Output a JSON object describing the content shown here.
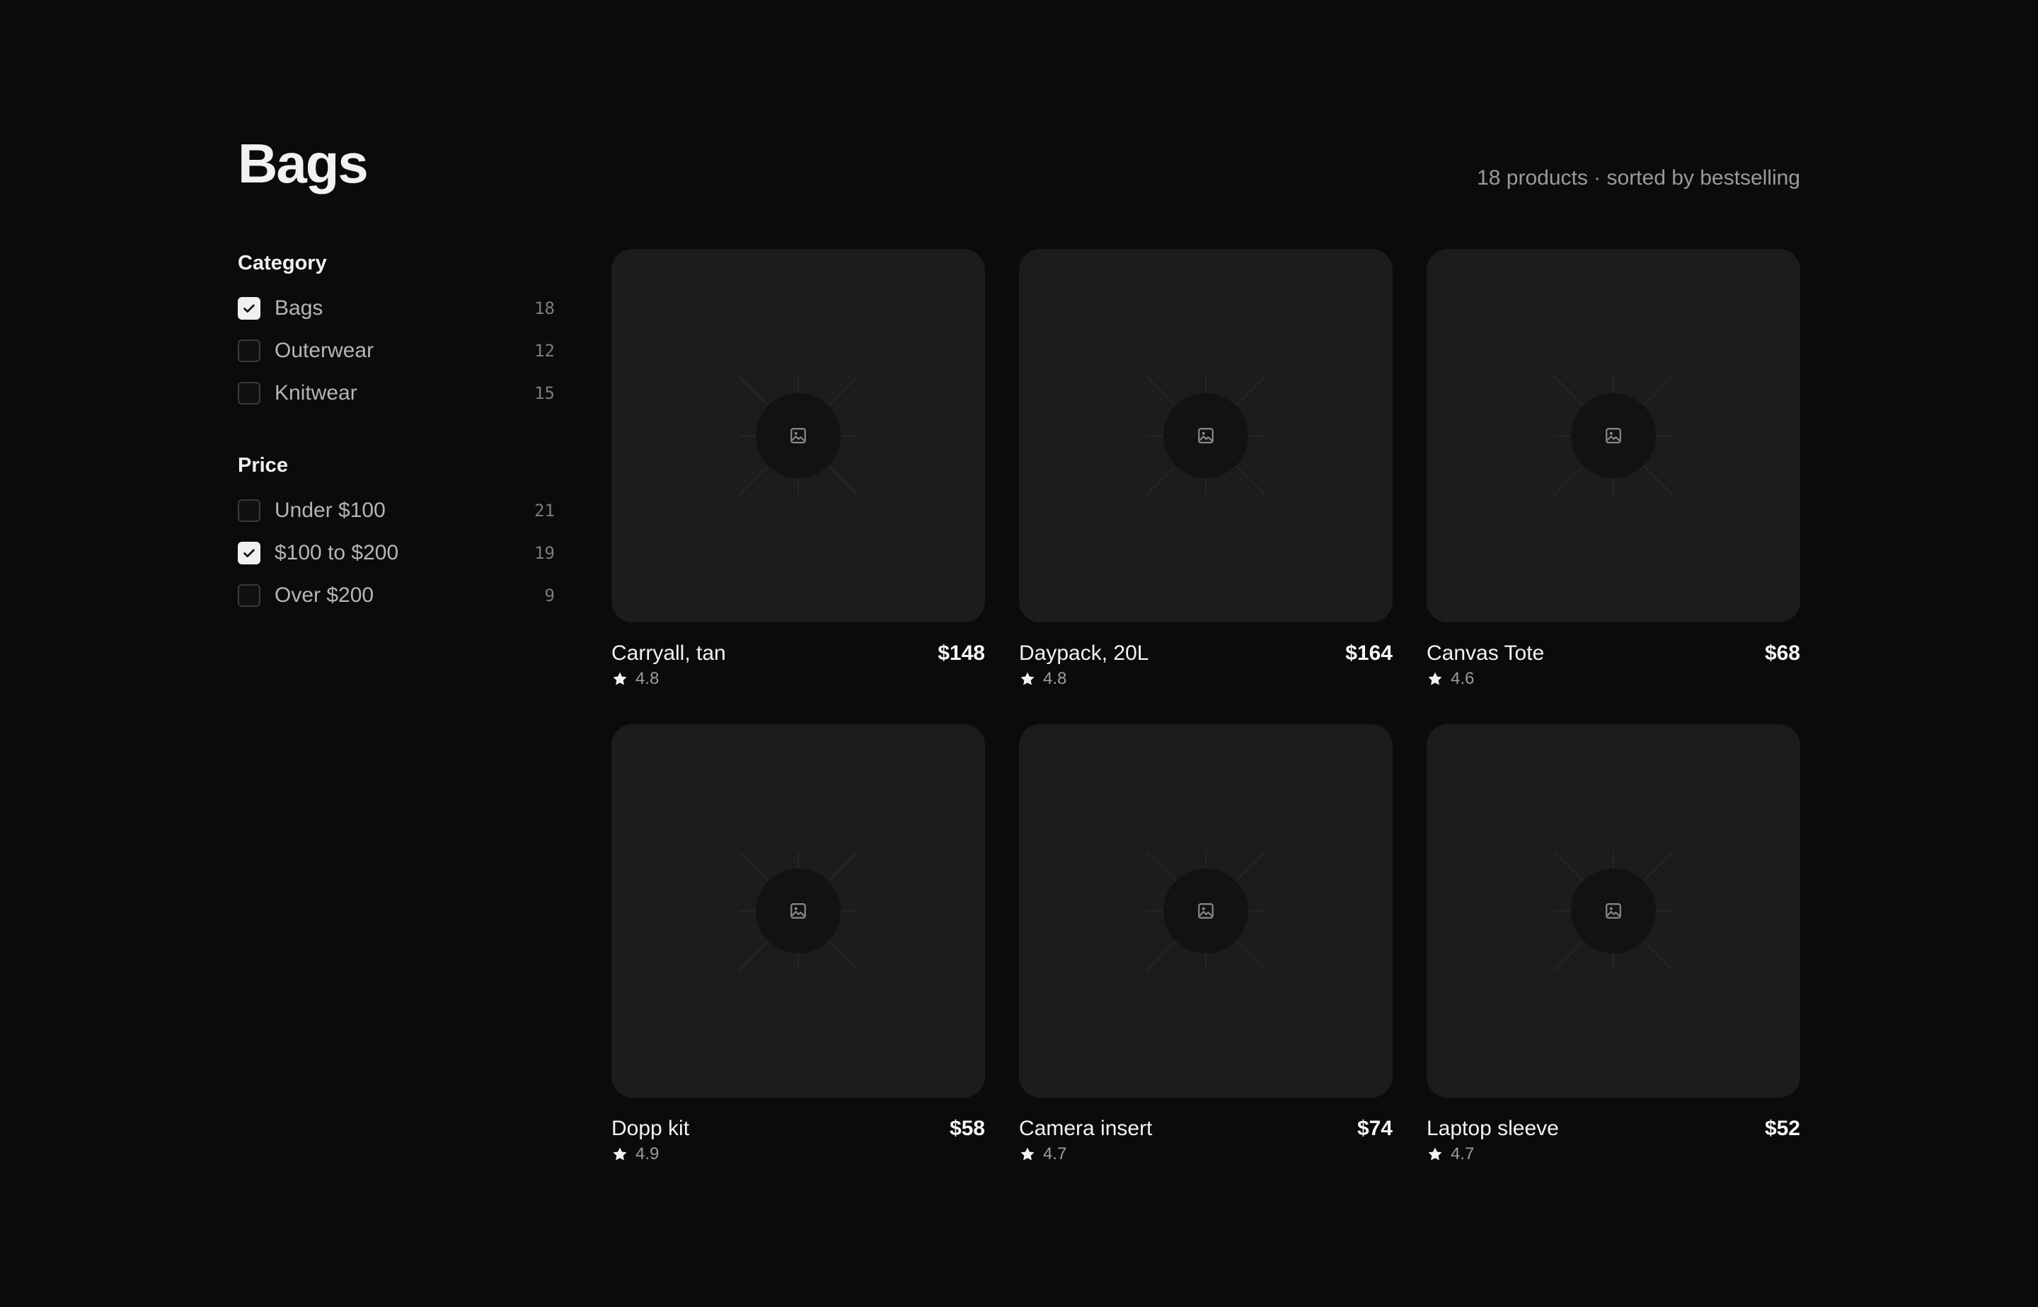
{
  "header": {
    "title": "Bags",
    "summary": "18 products · sorted by bestselling"
  },
  "filters": {
    "category": {
      "heading": "Category",
      "options": [
        {
          "label": "Bags",
          "count": "18",
          "checked": true
        },
        {
          "label": "Outerwear",
          "count": "12",
          "checked": false
        },
        {
          "label": "Knitwear",
          "count": "15",
          "checked": false
        }
      ]
    },
    "price": {
      "heading": "Price",
      "options": [
        {
          "label": "Under $100",
          "count": "21",
          "checked": false
        },
        {
          "label": "$100 to $200",
          "count": "19",
          "checked": true
        },
        {
          "label": "Over $200",
          "count": "9",
          "checked": false
        }
      ]
    }
  },
  "products": [
    {
      "name": "Carryall, tan",
      "price": "$148",
      "rating": "4.8"
    },
    {
      "name": "Daypack, 20L",
      "price": "$164",
      "rating": "4.8"
    },
    {
      "name": "Canvas Tote",
      "price": "$68",
      "rating": "4.6"
    },
    {
      "name": "Dopp kit",
      "price": "$58",
      "rating": "4.9"
    },
    {
      "name": "Camera insert",
      "price": "$74",
      "rating": "4.7"
    },
    {
      "name": "Laptop sleeve",
      "price": "$52",
      "rating": "4.7"
    }
  ],
  "icons": {
    "checkbox_check": "check-icon",
    "product_placeholder": "image-placeholder-icon",
    "rating": "star-icon"
  },
  "colors": {
    "background": "#0b0b0b",
    "card": "#1c1c1c",
    "checked": "#f0f0f0"
  }
}
